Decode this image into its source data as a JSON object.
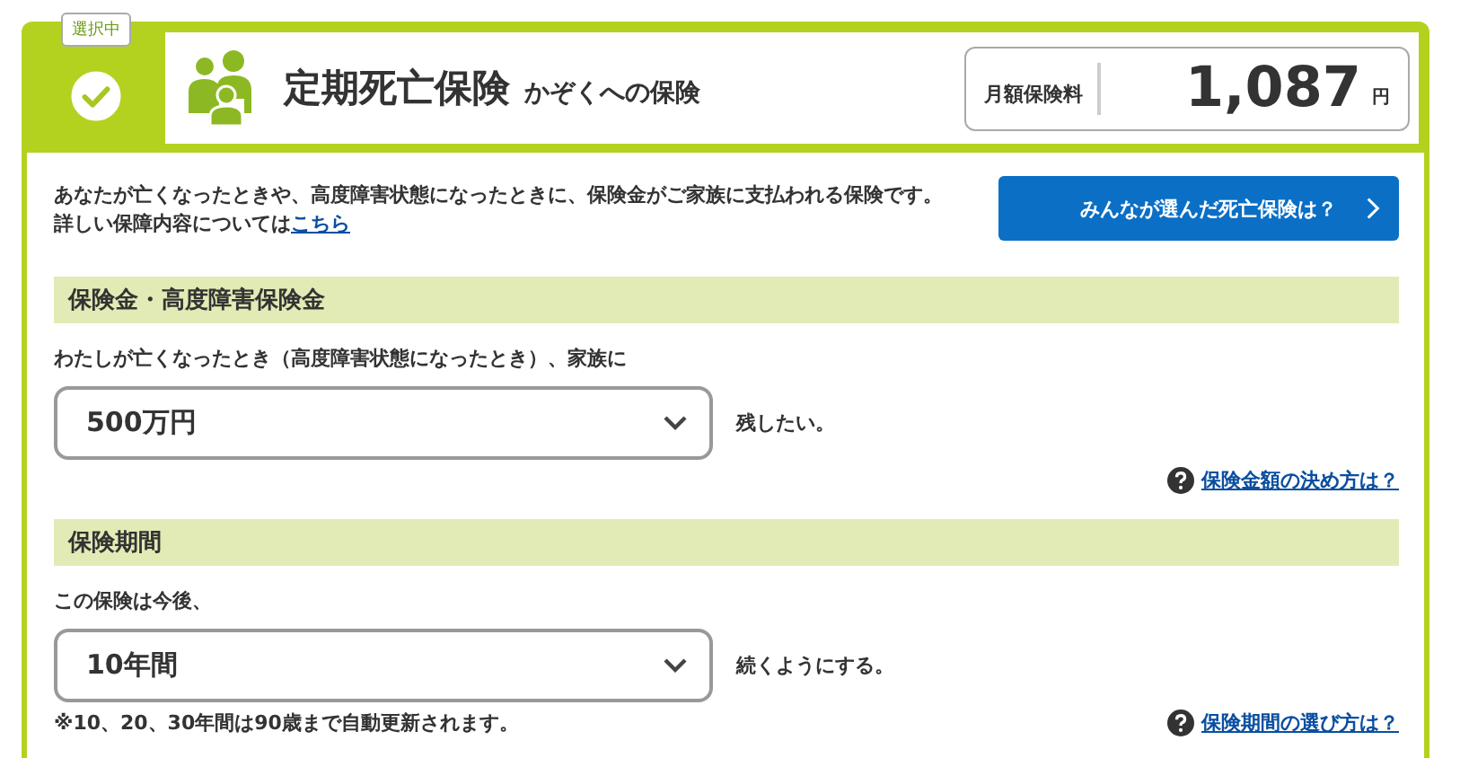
{
  "status_badge": {
    "label": "選択中",
    "checked": true
  },
  "plan": {
    "title": "定期死亡保険",
    "subtitle": "かぞくへの保険"
  },
  "premium": {
    "label": "月額保険料",
    "amount": "1,087",
    "unit": "円"
  },
  "description": {
    "text": "あなたが亡くなったときや、高度障害状態になったときに、保険金がご家族に支払われる保険です。",
    "detail_prefix": "詳しい保障内容については",
    "detail_link": "こちら"
  },
  "compare_button": {
    "label": "みんなが選んだ死亡保険は？"
  },
  "sections": [
    {
      "heading": "保険金・高度障害保険金",
      "prompt": "わたしが亡くなったとき（高度障害状態になったとき）、家族に",
      "select": {
        "value": "500万円"
      },
      "suffix": "残したい。",
      "help_link": "保険金額の決め方は？"
    },
    {
      "heading": "保険期間",
      "prompt": "この保険は今後、",
      "select": {
        "value": "10年間"
      },
      "suffix": "続くようにする。",
      "note": "※10、20、30年間は90歳まで自動更新されます。",
      "help_link": "保険期間の選び方は？"
    }
  ]
}
